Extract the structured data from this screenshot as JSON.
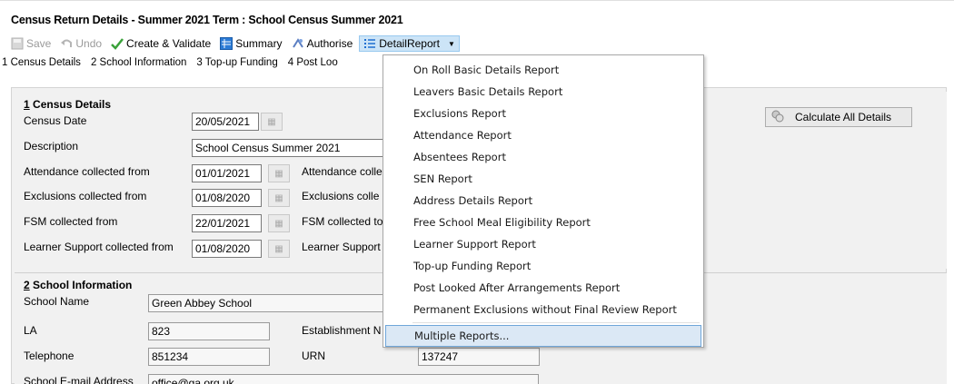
{
  "window": {
    "title": "Census Return Details - Summer 2021 Term : School Census Summer 2021"
  },
  "toolbar": {
    "save": "Save",
    "undo": "Undo",
    "create_validate": "Create & Validate",
    "summary": "Summary",
    "authorise": "Authorise",
    "detail_report": "DetailReport"
  },
  "tabs": [
    "1 Census Details",
    "2 School Information",
    "3 Top-up Funding",
    "4 Post Loo"
  ],
  "census_details": {
    "title_num": "1",
    "title_text": " Census Details",
    "census_date_label": "Census Date",
    "census_date": "20/05/2021",
    "description_label": "Description",
    "description": "School Census Summer 2021",
    "attendance_from_label": "Attendance collected from",
    "attendance_from": "01/01/2021",
    "attendance_to_label": "Attendance colle",
    "exclusions_from_label": "Exclusions collected from",
    "exclusions_from": "01/08/2020",
    "exclusions_to_label": "Exclusions colle",
    "fsm_from_label": "FSM collected from",
    "fsm_from": "22/01/2021",
    "fsm_to_label": "FSM collected to",
    "learner_from_label": "Learner Support collected from",
    "learner_from": "01/08/2020",
    "learner_to_label": "Learner Support"
  },
  "calculate_button": "Calculate All Details",
  "school_info": {
    "title_num": "2",
    "title_text": " School Information",
    "school_name_label": "School Name",
    "school_name": "Green Abbey School",
    "la_label": "LA",
    "la": "823",
    "estab_label": "Establishment N",
    "telephone_label": "Telephone",
    "telephone": "851234",
    "urn_label": "URN",
    "urn": "137247",
    "email_label": "School E-mail Address",
    "email": "office@ga.org.uk"
  },
  "detail_menu": [
    "On Roll Basic Details Report",
    "Leavers Basic Details Report",
    "Exclusions Report",
    "Attendance Report",
    "Absentees Report",
    "SEN Report",
    "Address Details Report",
    "Free School Meal Eligibility Report",
    "Learner Support Report",
    "Top-up Funding Report",
    "Post Looked After Arrangements Report",
    "Permanent Exclusions without Final Review Report",
    "Multiple Reports..."
  ],
  "colors": {
    "menu_hover": "#dbe8f5",
    "menu_hover_border": "#6fa6d9",
    "panel": "#f1f1f1"
  }
}
